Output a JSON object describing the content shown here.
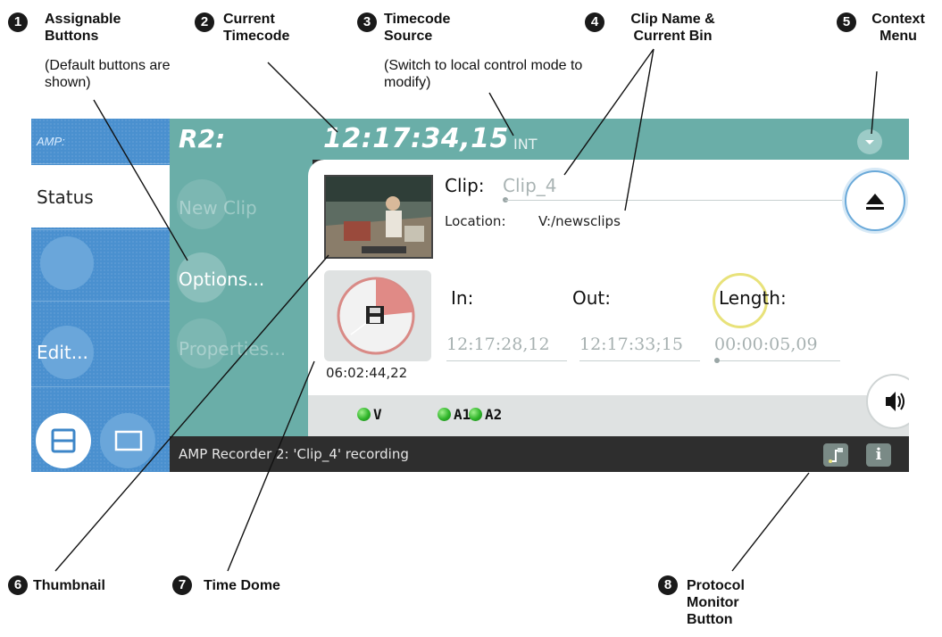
{
  "screen": {
    "amp_tag": "AMP:",
    "status_tab": "Status",
    "edit_button": "Edit...",
    "recorder": "R2:",
    "timecode": "12:17:34,15",
    "timecode_source": "INT",
    "assign_buttons": [
      "New Clip",
      "Options...",
      "Properties..."
    ],
    "clip_label": "Clip:",
    "clip_name": "Clip_4",
    "location_label": "Location:",
    "location_value": "V:/newsclips",
    "time_dome_value": "06:02:44,22",
    "in_label": "In:",
    "out_label": "Out:",
    "length_label": "Length:",
    "in_value": "12:17:28,12",
    "out_value": "12:17:33;15",
    "length_value": "00:00:05,09",
    "leds": [
      "V",
      "A1",
      "A2"
    ],
    "status_message": "AMP Recorder 2: 'Clip_4' recording",
    "info_icon": "i"
  },
  "callouts": [
    {
      "num": "1",
      "title": "Assignable Buttons",
      "note": "(Default buttons are shown)"
    },
    {
      "num": "2",
      "title": "Current Timecode"
    },
    {
      "num": "3",
      "title": "Timecode Source",
      "note": "(Switch to local control mode to modify)"
    },
    {
      "num": "4",
      "title": "Clip Name & Current Bin"
    },
    {
      "num": "5",
      "title": "Context Menu"
    },
    {
      "num": "6",
      "title": "Thumbnail"
    },
    {
      "num": "7",
      "title": "Time Dome"
    },
    {
      "num": "8",
      "title": "Protocol Monitor Button"
    }
  ],
  "icons": [
    "eject-icon",
    "speaker-icon",
    "floppy-disk-icon",
    "context-menu-chevron-icon",
    "protocol-monitor-icon",
    "info-icon",
    "split-view-icon",
    "single-view-icon"
  ],
  "colors": {
    "left_column": "#4a90cf",
    "teal": "#6aaea8",
    "status_bar": "#2e2e2e",
    "led_green": "#2fb52a",
    "eject_ring": "#6aa9d9",
    "length_ring": "#e8e27a"
  }
}
